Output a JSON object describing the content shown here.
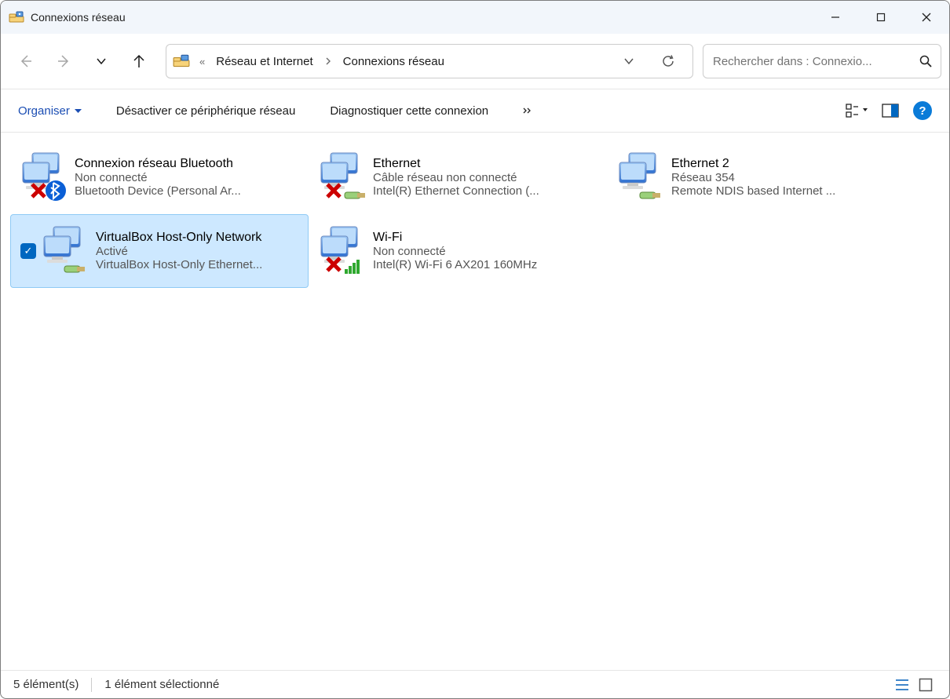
{
  "window": {
    "title": "Connexions réseau"
  },
  "breadcrumb": {
    "parent": "Réseau et Internet",
    "current": "Connexions réseau"
  },
  "search": {
    "placeholder": "Rechercher dans : Connexio..."
  },
  "commands": {
    "organize": "Organiser",
    "disable_device": "Désactiver ce périphérique réseau",
    "diagnose": "Diagnostiquer cette connexion"
  },
  "connections": [
    {
      "name": "Connexion réseau Bluetooth",
      "status": "Non connecté",
      "device": "Bluetooth Device (Personal Ar...",
      "icon": "bluetooth",
      "selected": false
    },
    {
      "name": "Ethernet",
      "status": "Câble réseau non connecté",
      "device": "Intel(R) Ethernet Connection (...",
      "icon": "eth-x",
      "selected": false
    },
    {
      "name": "Ethernet 2",
      "status": "Réseau 354",
      "device": "Remote NDIS based Internet ...",
      "icon": "eth",
      "selected": false
    },
    {
      "name": "VirtualBox Host-Only Network",
      "status": "Activé",
      "device": "VirtualBox Host-Only Ethernet...",
      "icon": "eth",
      "selected": true
    },
    {
      "name": "Wi-Fi",
      "status": "Non connecté",
      "device": "Intel(R) Wi-Fi 6 AX201 160MHz",
      "icon": "wifi-x",
      "selected": false
    }
  ],
  "statusbar": {
    "count": "5 élément(s)",
    "selected": "1 élément sélectionné"
  }
}
